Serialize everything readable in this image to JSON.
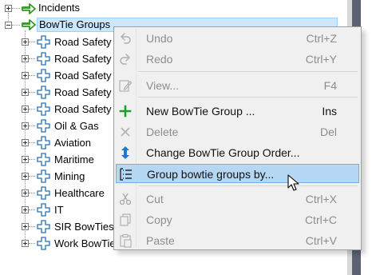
{
  "tree": {
    "top_item": {
      "label": "Incidents",
      "icon": "right-arrow-icon"
    },
    "selected_item": {
      "label": "BowTie Groups",
      "icon": "right-arrow-icon"
    },
    "children": [
      {
        "label": "Road Safety",
        "icon": "plus-cross-icon"
      },
      {
        "label": "Road Safety",
        "icon": "plus-cross-icon"
      },
      {
        "label": "Road Safety",
        "icon": "plus-cross-icon"
      },
      {
        "label": "Road Safety",
        "icon": "plus-cross-icon"
      },
      {
        "label": "Road Safety",
        "icon": "plus-cross-icon"
      },
      {
        "label": "Oil & Gas",
        "icon": "plus-cross-icon"
      },
      {
        "label": "Aviation",
        "icon": "plus-cross-icon"
      },
      {
        "label": "Maritime",
        "icon": "plus-cross-icon"
      },
      {
        "label": "Mining",
        "icon": "plus-cross-icon"
      },
      {
        "label": "Healthcare",
        "icon": "plus-cross-icon"
      },
      {
        "label": "IT",
        "icon": "plus-cross-icon"
      },
      {
        "label": "SIR BowTies",
        "icon": "plus-cross-icon"
      },
      {
        "label": "Work BowTies",
        "icon": "plus-cross-icon"
      }
    ]
  },
  "context_menu": {
    "items": [
      {
        "label": "Undo",
        "shortcut": "Ctrl+Z",
        "icon": "undo-icon",
        "enabled": false
      },
      {
        "label": "Redo",
        "shortcut": "Ctrl+Y",
        "icon": "redo-icon",
        "enabled": false
      },
      {
        "label": "View...",
        "shortcut": "F4",
        "icon": "edit-icon",
        "enabled": false
      },
      {
        "label": "New BowTie Group ...",
        "shortcut": "Ins",
        "icon": "add-icon",
        "enabled": true
      },
      {
        "label": "Delete",
        "shortcut": "Del",
        "icon": "delete-x-icon",
        "enabled": false
      },
      {
        "label": "Change BowTie Group Order...",
        "shortcut": "",
        "icon": "sort-order-icon",
        "enabled": true
      },
      {
        "label": "Group bowtie groups by...",
        "shortcut": "",
        "icon": "group-by-icon",
        "enabled": true,
        "highlighted": true
      },
      {
        "label": "Cut",
        "shortcut": "Ctrl+X",
        "icon": "scissors-icon",
        "enabled": false
      },
      {
        "label": "Copy",
        "shortcut": "Ctrl+C",
        "icon": "copy-icon",
        "enabled": false
      },
      {
        "label": "Paste",
        "shortcut": "Ctrl+V",
        "icon": "paste-icon",
        "enabled": false
      }
    ]
  },
  "colors": {
    "selection_fill": "#cce8ff",
    "menu_highlight": "#b5d7f3",
    "arrow_green": "#2e9a1f",
    "add_green": "#1f9e2a",
    "sort_blue": "#1f78d1",
    "menu_background": "#f0f0f0",
    "scroll_strip_dark": "#5c6275"
  }
}
